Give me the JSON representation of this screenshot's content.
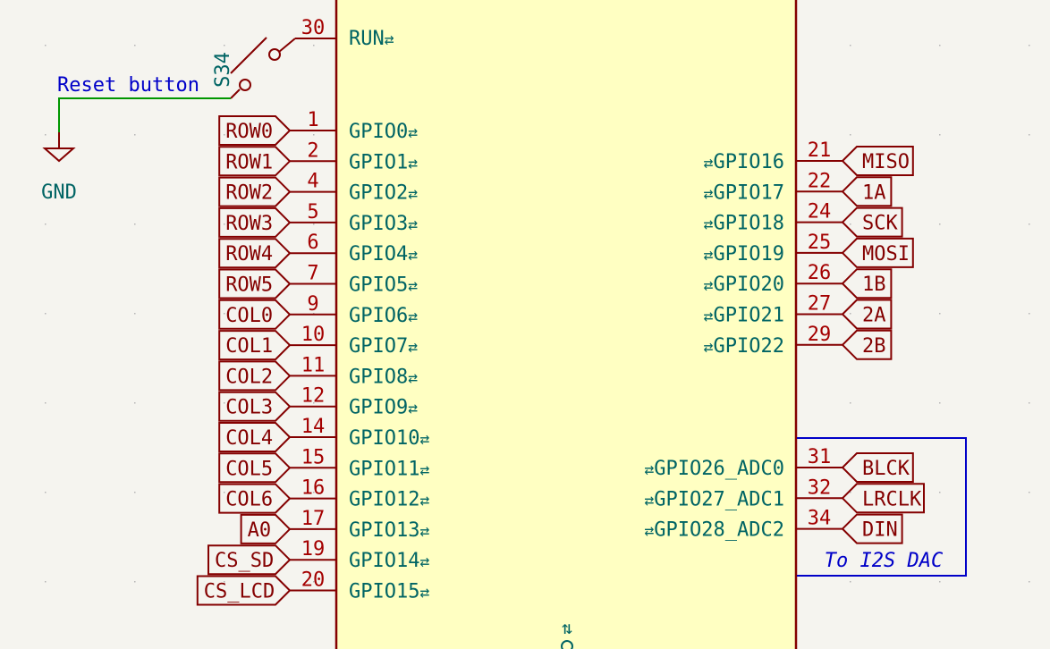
{
  "colors": {
    "background": "#f5f4ef",
    "symbol": "#840000",
    "symbol_fill": "#ffffc2",
    "pin_name": "#006464",
    "pin_number": "#a40000",
    "wire": "#009600",
    "label_text": "#840000",
    "note": "#0000c8",
    "power": "#840000",
    "power_text": "#006464",
    "grid": "#b5b5b5"
  },
  "reset_switch": {
    "ref": "S34",
    "pin_number": "30",
    "pin_name": "RUN",
    "net_label": "Reset button"
  },
  "ground": {
    "label": "GND"
  },
  "left_pins": [
    {
      "number": "1",
      "name": "GPIO0",
      "net": "ROW0"
    },
    {
      "number": "2",
      "name": "GPIO1",
      "net": "ROW1"
    },
    {
      "number": "4",
      "name": "GPIO2",
      "net": "ROW2"
    },
    {
      "number": "5",
      "name": "GPIO3",
      "net": "ROW3"
    },
    {
      "number": "6",
      "name": "GPIO4",
      "net": "ROW4"
    },
    {
      "number": "7",
      "name": "GPIO5",
      "net": "ROW5"
    },
    {
      "number": "9",
      "name": "GPIO6",
      "net": "COL0"
    },
    {
      "number": "10",
      "name": "GPIO7",
      "net": "COL1"
    },
    {
      "number": "11",
      "name": "GPIO8",
      "net": "COL2"
    },
    {
      "number": "12",
      "name": "GPIO9",
      "net": "COL3"
    },
    {
      "number": "14",
      "name": "GPIO10",
      "net": "COL4"
    },
    {
      "number": "15",
      "name": "GPIO11",
      "net": "COL5"
    },
    {
      "number": "16",
      "name": "GPIO12",
      "net": "COL6"
    },
    {
      "number": "17",
      "name": "GPIO13",
      "net": "A0"
    },
    {
      "number": "19",
      "name": "GPIO14",
      "net": "CS_SD"
    },
    {
      "number": "20",
      "name": "GPIO15",
      "net": "CS_LCD"
    }
  ],
  "right_pins": [
    {
      "number": "21",
      "name": "GPIO16",
      "net": "MISO"
    },
    {
      "number": "22",
      "name": "GPIO17",
      "net": "1A"
    },
    {
      "number": "24",
      "name": "GPIO18",
      "net": "SCK"
    },
    {
      "number": "25",
      "name": "GPIO19",
      "net": "MOSI"
    },
    {
      "number": "26",
      "name": "GPIO20",
      "net": "1B"
    },
    {
      "number": "27",
      "name": "GPIO21",
      "net": "2A"
    },
    {
      "number": "29",
      "name": "GPIO22",
      "net": "2B"
    }
  ],
  "adc_pins": [
    {
      "number": "31",
      "name": "GPIO26_ADC0",
      "net": "BLCK"
    },
    {
      "number": "32",
      "name": "GPIO27_ADC1",
      "net": "LRCLK"
    },
    {
      "number": "34",
      "name": "GPIO28_ADC2",
      "net": "DIN"
    }
  ],
  "dac_note": "To I2S DAC",
  "bidir_glyph": "⇄",
  "bottom_pin_glyph": "⇅"
}
